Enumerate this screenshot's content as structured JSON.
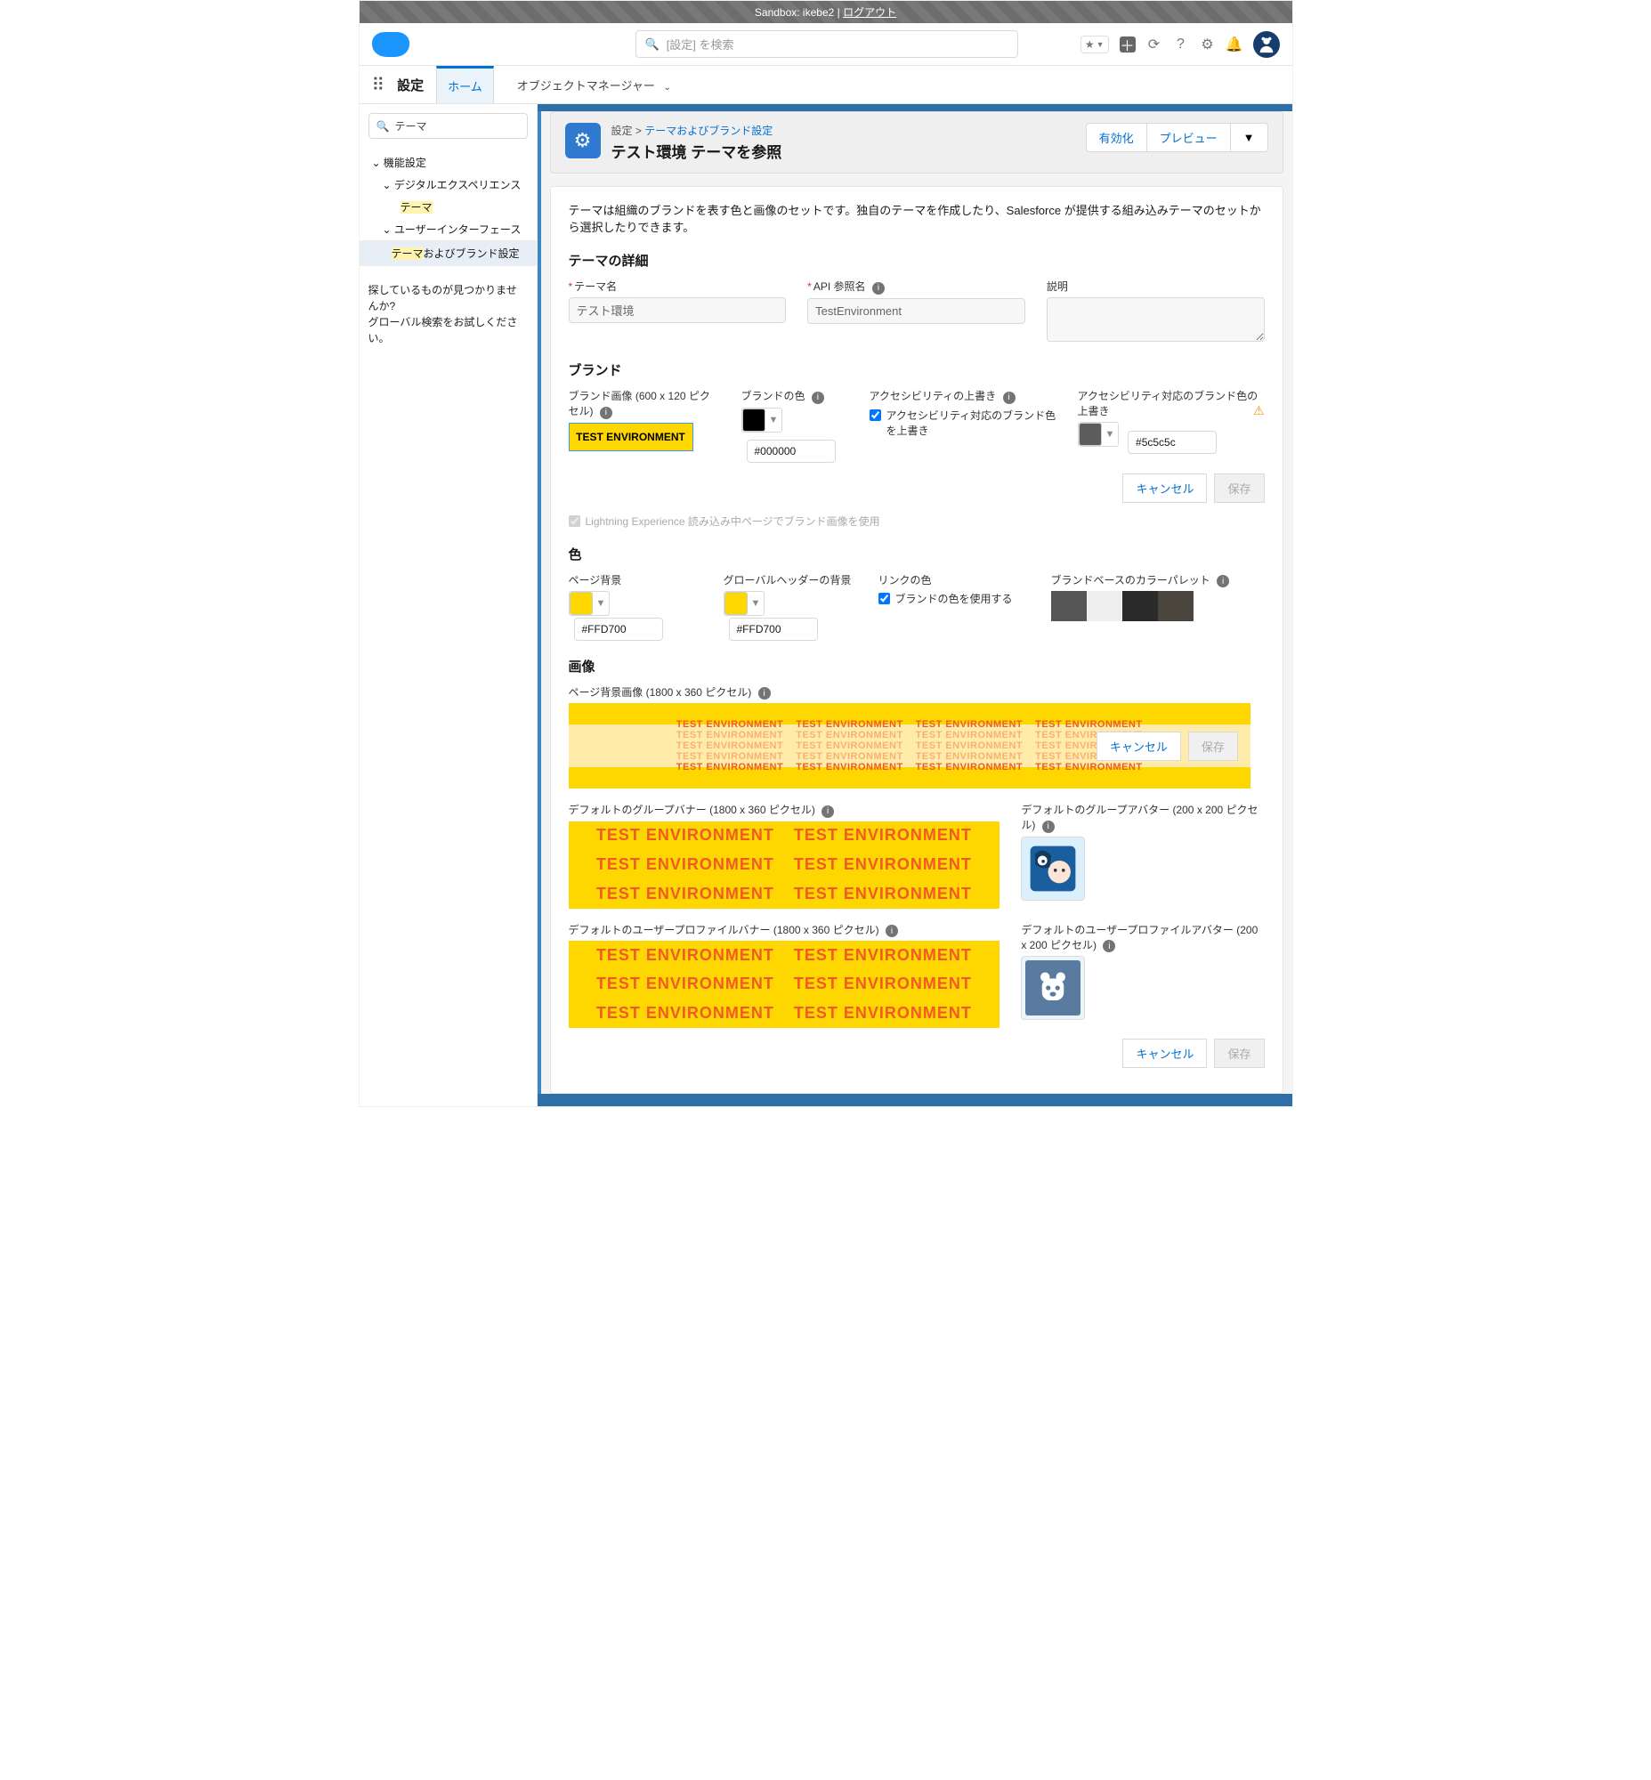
{
  "sandbox": {
    "text": "Sandbox: ikebe2 | ",
    "logout": "ログアウト"
  },
  "header": {
    "search_placeholder": "[設定] を検索",
    "icons": [
      "plus",
      "sync",
      "question",
      "gear",
      "bell"
    ]
  },
  "nav": {
    "setup_label": "設定",
    "tab_home": "ホーム",
    "tab_obj": "オブジェクトマネージャー"
  },
  "sidebar": {
    "quickfind": "テーマ",
    "n1": "機能設定",
    "n2": "デジタルエクスペリエンス",
    "n3": "テーマ",
    "n4": "ユーザーインターフェース",
    "n5_pre": "テーマ",
    "n5_post": "およびブランド設定",
    "help1": "探しているものが見つかりませんか?",
    "help2": "グローバル検索をお試しください。"
  },
  "page": {
    "crumb_setup": "設定",
    "crumb_theming": "テーマおよびブランド設定",
    "title": "テスト環境 テーマを参照",
    "btn_activate": "有効化",
    "btn_preview": "プレビュー",
    "btn_menu": "▼"
  },
  "intro": "テーマは組織のブランドを表す色と画像のセットです。独自のテーマを作成したり、Salesforce が提供する組み込みテーマのセットから選択したりできます。",
  "details": {
    "heading": "テーマの詳細",
    "name_label": "テーマ名",
    "name_value": "テスト環境",
    "api_label": "API 参照名",
    "api_value": "TestEnvironment",
    "desc_label": "説明"
  },
  "brand": {
    "heading": "ブランド",
    "image_label": "ブランド画像 (600 x 120 ピクセル)",
    "image_text": "TEST ENVIRONMENT",
    "color_label": "ブランドの色",
    "color_value": "#000000",
    "a11y_override_label": "アクセシビリティの上書き",
    "a11y_checkbox": "アクセシビリティ対応のブランド色を上書き",
    "a11y_color_label": "アクセシビリティ対応のブランド色の上書き",
    "a11y_color_value": "#5c5c5c",
    "lightning_checkbox": "Lightning Experience 読み込み中ページでブランド画像を使用",
    "cancel": "キャンセル",
    "save": "保存"
  },
  "colors": {
    "heading": "色",
    "page_bg_label": "ページ背景",
    "page_bg_value": "#FFD700",
    "header_bg_label": "グローバルヘッダーの背景",
    "header_bg_value": "#FFD700",
    "link_label": "リンクの色",
    "link_checkbox": "ブランドの色を使用する",
    "palette_label": "ブランドベースのカラーパレット",
    "palette": [
      "#555555",
      "#eeeeee",
      "#2a2a2a",
      "#4a463e"
    ]
  },
  "images": {
    "heading": "画像",
    "page_bg_label": "ページ背景画像 (1800 x 360 ピクセル)",
    "test_text": "TEST ENVIRONMENT",
    "group_banner_label": "デフォルトのグループバナー (1800 x 360 ピクセル)",
    "group_avatar_label": "デフォルトのグループアバター (200 x 200 ピクセル)",
    "user_banner_label": "デフォルトのユーザープロファイルバナー (1800 x 360 ピクセル)",
    "user_avatar_label": "デフォルトのユーザープロファイルアバター (200 x 200 ピクセル)",
    "cancel": "キャンセル",
    "save": "保存"
  }
}
